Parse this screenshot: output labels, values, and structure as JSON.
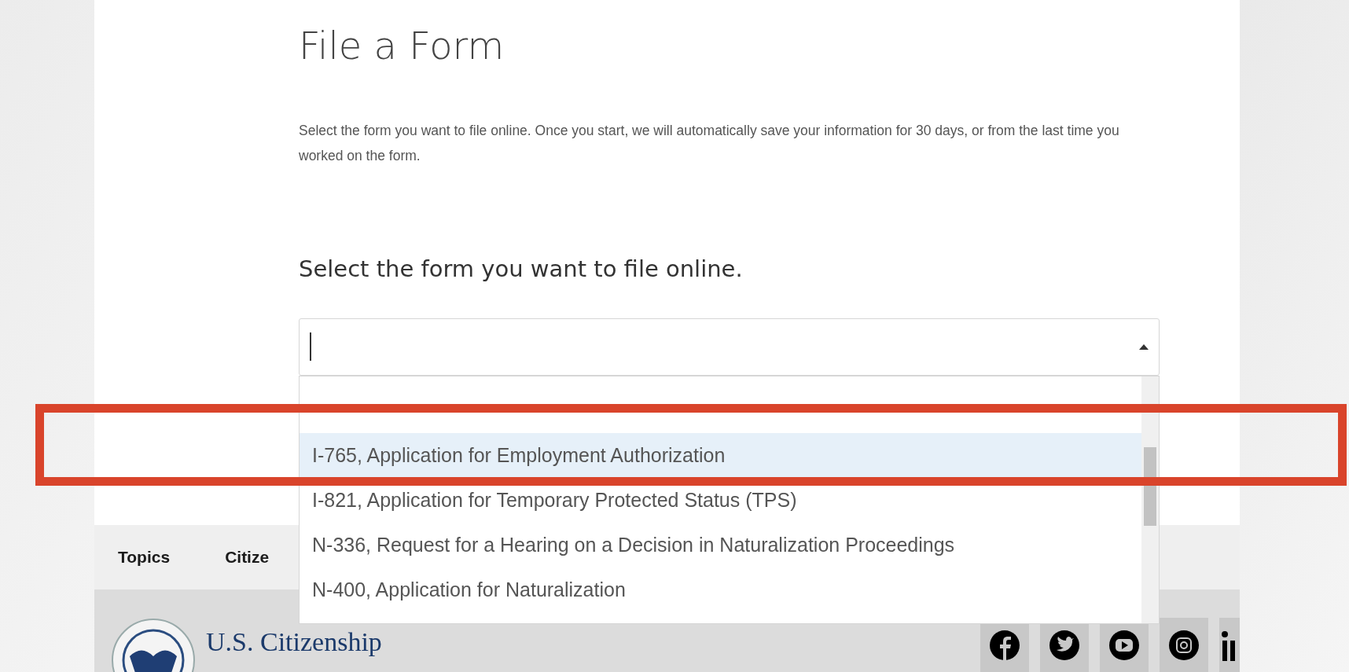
{
  "heading": "File a Form",
  "intro": "Select the form you want to file online. Once you start, we will automatically save your information for 30 days, or from the last time you worked on the form.",
  "prompt": "Select the form you want to file online.",
  "combo": {
    "expanded": true,
    "options": [
      {
        "label": "I-765, Application for Employment Authorization",
        "selected": true
      },
      {
        "label": "I-821, Application for Temporary Protected Status (TPS)",
        "selected": false
      },
      {
        "label": "N-336, Request for a Hearing on a Decision in Naturalization Proceedings",
        "selected": false
      },
      {
        "label": "N-400, Application for Naturalization",
        "selected": false
      }
    ]
  },
  "footer": {
    "nav": [
      "Topics",
      "Citize"
    ],
    "brand": "U.S. Citizenship"
  }
}
